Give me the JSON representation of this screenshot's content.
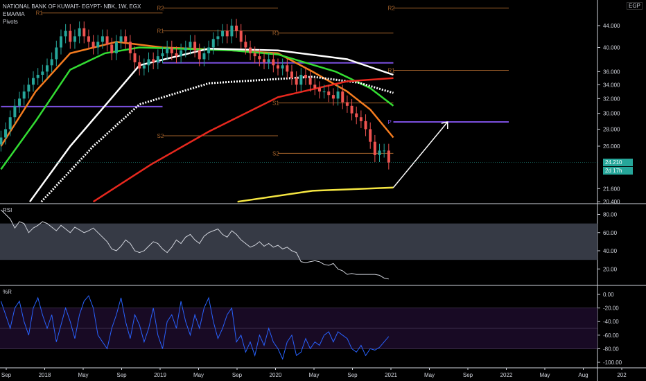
{
  "header": {
    "title": "NATIONAL BANK OF KUWAIT- EGYPT- NBK, 1W, EGX",
    "indicators": [
      "EMA/MA",
      "Pivots"
    ]
  },
  "price_axis": {
    "currency": "EGP",
    "ticks": [
      "44.000",
      "40.000",
      "36.000",
      "34.000",
      "32.000",
      "30.000",
      "28.000",
      "26.000",
      "21.600",
      "20.400"
    ],
    "last_price": "24.210",
    "countdown": "2d 17h"
  },
  "rsi": {
    "label": "RSI",
    "ticks": [
      "80.00",
      "60.00",
      "40.00",
      "20.00"
    ]
  },
  "wr": {
    "label": "%R",
    "ticks": [
      "0.00",
      "-20.00",
      "-40.00",
      "-60.00",
      "-80.00",
      "-100.00"
    ]
  },
  "time_axis": {
    "labels": [
      "Sep",
      "2018",
      "May",
      "Sep",
      "2019",
      "May",
      "Sep",
      "2020",
      "May",
      "Sep",
      "2021",
      "May",
      "Sep",
      "2022",
      "May",
      "Aug",
      "202"
    ]
  },
  "colors": {
    "up": "#26a69a",
    "down": "#ef5350",
    "ema_fast": "#f57c1f",
    "ema_mid": "#33dd33",
    "ema_slow": "#ffffff",
    "ma_red": "#e8281e",
    "ma_yellow": "#f5e642",
    "pivot_p": "#7b4fe0",
    "pivot_lines": "#a0602a",
    "rsi_line": "#d1d4dc",
    "wr_line": "#2962ff"
  },
  "chart_data": {
    "type": "candlestick",
    "title": "NATIONAL BANK OF KUWAIT- EGYPT- NBK, 1W, EGX",
    "ylabel": "EGP",
    "ylim": [
      20.4,
      48
    ],
    "yscale": "log",
    "x_start": 2017.6,
    "x_step": 0.04,
    "closes": [
      27,
      28,
      29.5,
      31,
      32,
      33,
      34,
      35,
      35.5,
      36,
      37,
      38,
      40,
      42,
      43,
      41,
      42,
      43.5,
      42,
      41,
      40,
      41,
      42,
      40.5,
      39,
      41,
      42,
      41,
      39,
      37.5,
      36.5,
      37,
      38,
      37.5,
      38.5,
      39,
      40,
      39,
      38.5,
      39.5,
      40,
      41,
      39.5,
      38,
      39,
      40,
      41.5,
      42,
      43,
      42,
      44,
      43,
      41,
      40,
      39,
      38.5,
      38,
      37.5,
      38,
      37,
      36.5,
      37,
      36,
      35,
      34,
      35.5,
      35,
      34,
      33.5,
      33,
      33,
      32.5,
      32,
      33,
      31.5,
      31,
      30,
      29.5,
      29,
      28,
      26.5,
      25,
      25.5,
      25.5,
      24.21
    ],
    "series": [
      {
        "name": "EMA fast",
        "color": "#f57c1f",
        "points": [
          [
            2017.6,
            26
          ],
          [
            2017.9,
            33
          ],
          [
            2018.2,
            39
          ],
          [
            2018.6,
            41
          ],
          [
            2019.0,
            40
          ],
          [
            2019.5,
            39.6
          ],
          [
            2020.0,
            39
          ],
          [
            2020.3,
            36
          ],
          [
            2020.6,
            33
          ],
          [
            2020.8,
            30.5
          ],
          [
            2021.0,
            27
          ]
        ]
      },
      {
        "name": "EMA mid",
        "color": "#33dd33",
        "points": [
          [
            2017.6,
            23.5
          ],
          [
            2017.9,
            29
          ],
          [
            2018.2,
            36.3
          ],
          [
            2018.5,
            39
          ],
          [
            2018.8,
            40
          ],
          [
            2019.6,
            39.5
          ],
          [
            2020.0,
            38.8
          ],
          [
            2020.5,
            36
          ],
          [
            2020.8,
            33.5
          ],
          [
            2021.0,
            31
          ]
        ]
      },
      {
        "name": "EMA slow",
        "color": "#ffffff",
        "points": [
          [
            2017.85,
            20.4
          ],
          [
            2018.2,
            26
          ],
          [
            2018.5,
            31
          ],
          [
            2018.8,
            37
          ],
          [
            2019.4,
            39.8
          ],
          [
            2020.0,
            39.5
          ],
          [
            2020.6,
            38
          ],
          [
            2021.0,
            35.5
          ]
        ]
      },
      {
        "name": "MA dotted",
        "color": "#ffffff",
        "dotted": true,
        "points": [
          [
            2017.95,
            20.4
          ],
          [
            2018.4,
            26
          ],
          [
            2018.8,
            31.2
          ],
          [
            2019.4,
            34.2
          ],
          [
            2020.3,
            35.2
          ],
          [
            2020.7,
            34.3
          ],
          [
            2021.0,
            32.8
          ]
        ]
      },
      {
        "name": "MA red",
        "color": "#e8281e",
        "points": [
          [
            2018.4,
            20.4
          ],
          [
            2018.9,
            24
          ],
          [
            2019.4,
            27.7
          ],
          [
            2020.0,
            32.2
          ],
          [
            2020.6,
            34.5
          ],
          [
            2021.0,
            35
          ]
        ]
      },
      {
        "name": "MA yellow",
        "color": "#f5e642",
        "points": [
          [
            2019.65,
            20.4
          ],
          [
            2020.3,
            21.4
          ],
          [
            2021.0,
            21.7
          ]
        ]
      }
    ],
    "pivots": [
      {
        "label": "P",
        "value": 30.9,
        "from": 2017.6,
        "to": 2019.0,
        "type": "P"
      },
      {
        "label": "P",
        "value": 37.4,
        "from": 2019.0,
        "to": 2021.0,
        "type": "P"
      },
      {
        "label": "P",
        "value": 28.9,
        "from": 2021.0,
        "to": 2022.0,
        "type": "P"
      },
      {
        "label": "R1",
        "value": 46.5,
        "from": 2017.95,
        "to": 2019.0
      },
      {
        "label": "R2",
        "value": 47.5,
        "from": 2019.0,
        "to": 2020.0
      },
      {
        "label": "R1",
        "value": 43,
        "from": 2019.0,
        "to": 2020.0
      },
      {
        "label": "R1",
        "value": 42.6,
        "from": 2020.0,
        "to": 2021.0
      },
      {
        "label": "R1",
        "value": 36.2,
        "from": 2021.0,
        "to": 2022.0
      },
      {
        "label": "R2",
        "value": 47.5,
        "from": 2021.0,
        "to": 2022.0
      },
      {
        "label": "S1",
        "value": 31.4,
        "from": 2020.0,
        "to": 2021.0
      },
      {
        "label": "S2",
        "value": 25.2,
        "from": 2020.0,
        "to": 2021.0
      },
      {
        "label": "S2",
        "value": 27.2,
        "from": 2019.0,
        "to": 2020.0
      }
    ],
    "projection_arrow": {
      "from": [
        2021.0,
        21.7
      ],
      "to": [
        2021.47,
        28.9
      ]
    },
    "rsi_values": [
      85,
      80,
      75,
      65,
      72,
      70,
      60,
      65,
      68,
      72,
      70,
      66,
      62,
      68,
      64,
      60,
      66,
      63,
      60,
      62,
      65,
      60,
      55,
      50,
      42,
      40,
      45,
      52,
      48,
      40,
      38,
      40,
      45,
      50,
      48,
      42,
      38,
      44,
      52,
      48,
      55,
      58,
      52,
      48,
      56,
      60,
      62,
      64,
      58,
      55,
      62,
      58,
      52,
      48,
      44,
      46,
      50,
      45,
      48,
      44,
      46,
      42,
      44,
      40,
      38,
      28,
      27,
      28,
      29,
      28,
      25,
      24,
      26,
      20,
      18,
      14,
      15,
      14,
      14,
      14,
      14,
      14,
      13,
      10,
      9
    ],
    "rsi_band": [
      30,
      70
    ],
    "wr_values": [
      -10,
      -30,
      -50,
      -20,
      -10,
      -40,
      -60,
      -20,
      -5,
      -30,
      -50,
      -30,
      -70,
      -45,
      -20,
      -40,
      -65,
      -30,
      -10,
      -2,
      -20,
      -60,
      -70,
      -80,
      -50,
      -30,
      -5,
      -40,
      -65,
      -30,
      -45,
      -70,
      -50,
      -20,
      -60,
      -80,
      -40,
      -30,
      -50,
      -10,
      -40,
      -60,
      -30,
      -50,
      -20,
      -5,
      -40,
      -65,
      -50,
      -30,
      -20,
      -70,
      -60,
      -85,
      -70,
      -90,
      -60,
      -75,
      -50,
      -70,
      -80,
      -95,
      -70,
      -60,
      -90,
      -85,
      -65,
      -80,
      -70,
      -75,
      -60,
      -55,
      -70,
      -55,
      -60,
      -65,
      -80,
      -85,
      -75,
      -90,
      -80,
      -82,
      -78,
      -70,
      -62
    ],
    "wr_band": [
      -80,
      -20
    ]
  }
}
